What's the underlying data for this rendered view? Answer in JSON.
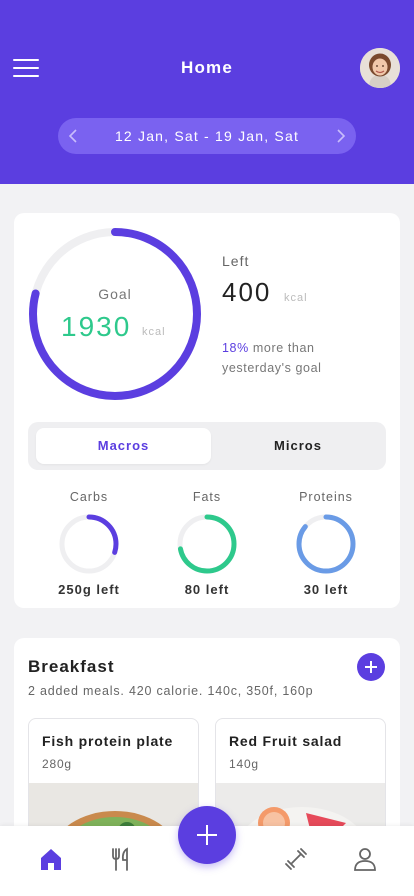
{
  "header": {
    "title": "Home",
    "date_range": "12 Jan, Sat - 19 Jan, Sat",
    "menu_icon": "hamburger-menu-icon",
    "avatar_icon": "user-avatar",
    "bg_color": "#5b3ee0"
  },
  "goal": {
    "goal_label": "Goal",
    "goal_value": "1930",
    "goal_unit": "kcal",
    "progress_fraction": 0.79,
    "left_label": "Left",
    "left_value": "400",
    "left_unit": "kcal",
    "compare_pct": "18%",
    "compare_text": "more than yesterday's goal"
  },
  "tabs": {
    "macros": "Macros",
    "micros": "Micros",
    "selected": "Macros"
  },
  "macros": [
    {
      "name": "Carbs",
      "left": "250g left",
      "fraction": 0.3,
      "color": "#5b3ee0"
    },
    {
      "name": "Fats",
      "left": "80 left",
      "fraction": 0.72,
      "color": "#2ec98c"
    },
    {
      "name": "Proteins",
      "left": "30 left",
      "fraction": 0.86,
      "color": "#6a9be6"
    }
  ],
  "breakfast": {
    "title": "Breakfast",
    "summary": "2 added meals. 420 calorie. 140c, 350f, 160p",
    "meals": [
      {
        "name": "Fish protein plate",
        "weight": "280g"
      },
      {
        "name": "Red Fruit salad",
        "weight": "140g"
      }
    ]
  },
  "nav": {
    "items": [
      "home-icon",
      "fork-knife-icon",
      "add-icon",
      "dumbbell-icon",
      "profile-icon"
    ],
    "active": "home-icon"
  },
  "colors": {
    "accent": "#5b3ee0",
    "green": "#2ec98c",
    "blue": "#6a9be6"
  }
}
